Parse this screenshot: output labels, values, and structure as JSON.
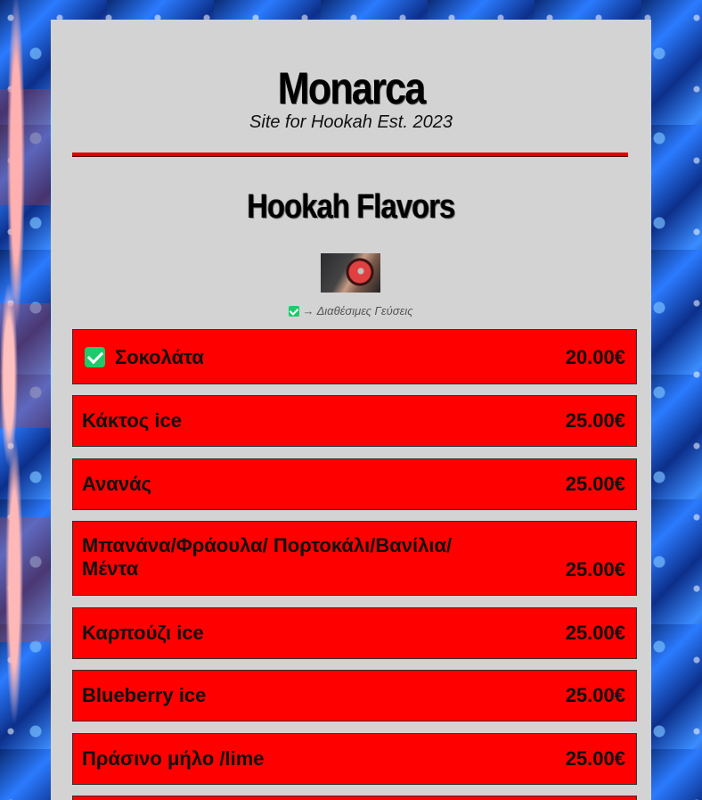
{
  "header": {
    "title": "Monarca",
    "subtitle": "Site for Hookah Est. 2023"
  },
  "section": {
    "title": "Hookah Flavors",
    "legend": "→ Διαθέσιμες Γεύσεις"
  },
  "colors": {
    "panel": "#d3d3d3",
    "item_bg": "#ff0000",
    "divider": "#e00000",
    "check": "#1ecb6a"
  },
  "icons": {
    "available": "check-square-icon"
  },
  "flavors": [
    {
      "name": "Σοκολάτα",
      "price": "20.00€",
      "available": true
    },
    {
      "name": "Κάκτος ice",
      "price": "25.00€",
      "available": false
    },
    {
      "name": "Ανανάς",
      "price": "25.00€",
      "available": false
    },
    {
      "name": "Μπανάνα/Φράουλα/ Πορτοκάλι/Βανίλια/Μέντα",
      "price": "25.00€",
      "available": false
    },
    {
      "name": "Καρπούζι ice",
      "price": "25.00€",
      "available": false
    },
    {
      "name": "Blueberry ice",
      "price": "25.00€",
      "available": false
    },
    {
      "name": "Πράσινο μήλο /lime",
      "price": "25.00€",
      "available": false
    }
  ]
}
